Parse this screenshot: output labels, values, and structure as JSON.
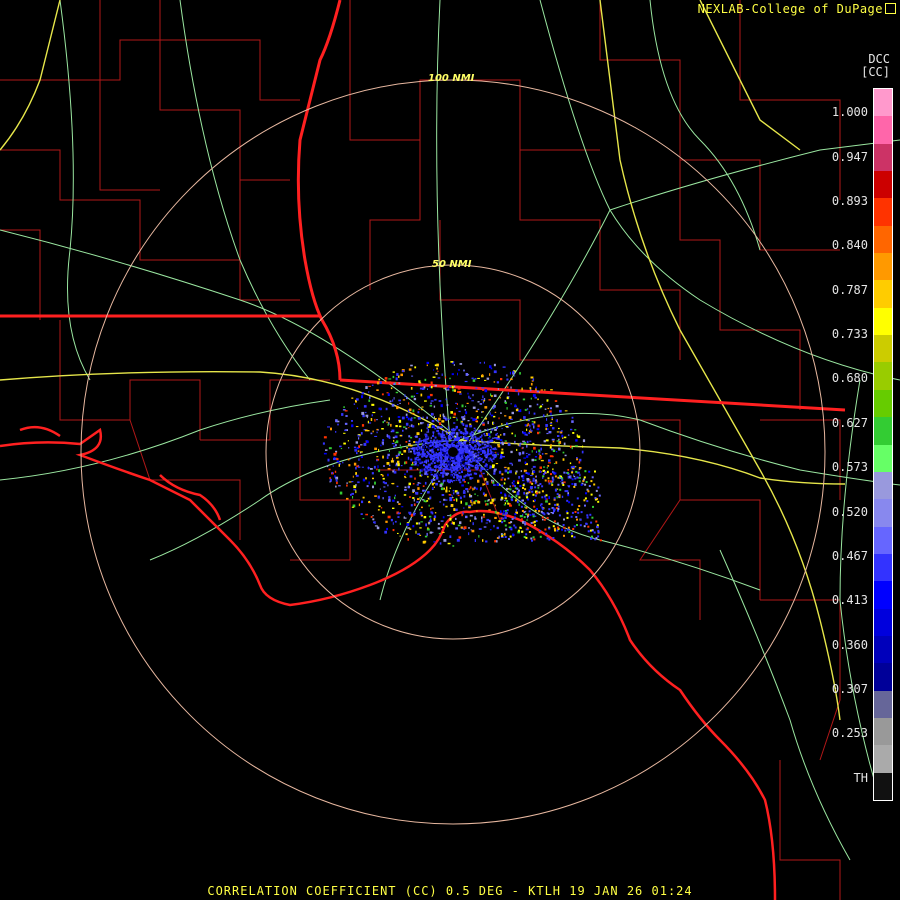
{
  "credit": "NEXLAB-College of DuPage",
  "product": {
    "code": "DCC",
    "unit": "[CC]"
  },
  "footer": "CORRELATION COEFFICIENT (CC) 0.5 DEG - KTLH 19 JAN 26 01:24",
  "rings": [
    {
      "label": "50 NMI",
      "radius_nmi": 50
    },
    {
      "label": "100 NMI",
      "radius_nmi": 100
    }
  ],
  "scale": {
    "labels": [
      "1.000",
      "0.947",
      "0.893",
      "0.840",
      "0.787",
      "0.733",
      "0.680",
      "0.627",
      "0.573",
      "0.520",
      "0.467",
      "0.413",
      "0.360",
      "0.307",
      "0.253",
      "TH"
    ],
    "colors": [
      "#ff99cc",
      "#ff66aa",
      "#cc3366",
      "#cc0000",
      "#ff3300",
      "#ff6600",
      "#ff9900",
      "#ffcc00",
      "#ffff00",
      "#cccc00",
      "#99cc00",
      "#66cc00",
      "#33cc33",
      "#66ff66",
      "#9999dd",
      "#8888ee",
      "#6666ff",
      "#3333ff",
      "#0000ff",
      "#0000dd",
      "#0000bb",
      "#000099",
      "#666699",
      "#999999",
      "#aaaaaa",
      "#111111"
    ]
  },
  "colors": {
    "state_border": "#ff2020",
    "county_border": "#b01818",
    "coastline": "#ff2020",
    "highway": "#9ae6a0",
    "interstate": "#e6e64a",
    "ring": "#e8b8a0",
    "echo_blue": "#3333ff"
  }
}
